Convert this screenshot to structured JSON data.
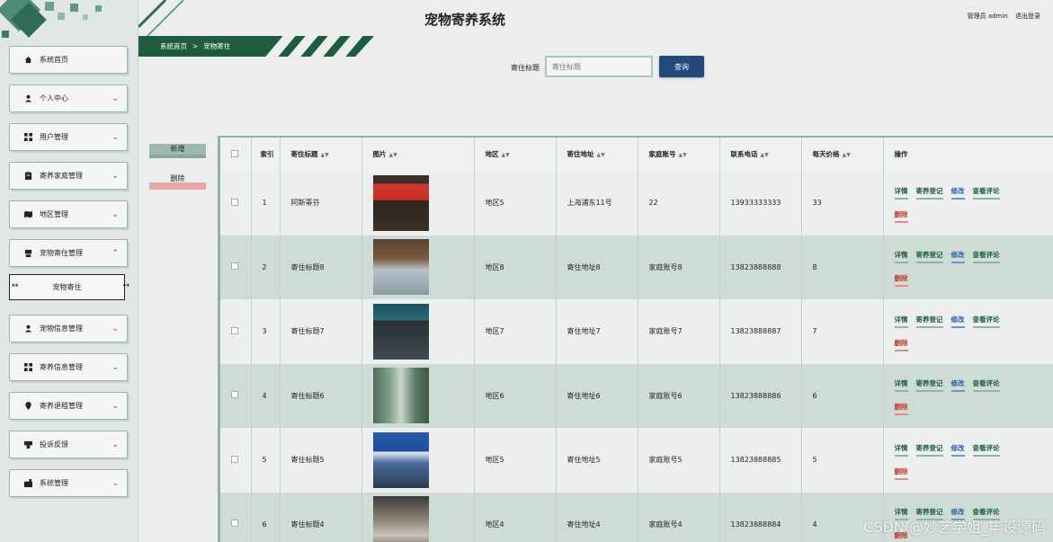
{
  "header": {
    "title": "宠物寄养系统",
    "user": "管理员 admin",
    "logout": "退出登录"
  },
  "sidebar": {
    "items": [
      {
        "label": "系统首页",
        "icon": "home-icon",
        "has_chevron": false
      },
      {
        "label": "个人中心",
        "icon": "person-icon",
        "has_chevron": true
      },
      {
        "label": "用户管理",
        "icon": "grid-icon",
        "has_chevron": true
      },
      {
        "label": "寄养家庭管理",
        "icon": "clipboard-icon",
        "has_chevron": true
      },
      {
        "label": "地区管理",
        "icon": "map-icon",
        "has_chevron": true
      },
      {
        "label": "宠物寄住管理",
        "icon": "house-icon",
        "has_chevron": true
      },
      {
        "label": "宠物信息管理",
        "icon": "person-icon",
        "has_chevron": true
      },
      {
        "label": "寄养信息管理",
        "icon": "grid-icon",
        "has_chevron": true
      },
      {
        "label": "寄养退租管理",
        "icon": "pin-icon",
        "has_chevron": true
      },
      {
        "label": "投诉反馈",
        "icon": "feedback-icon",
        "has_chevron": true
      },
      {
        "label": "系统管理",
        "icon": "gear-icon",
        "has_chevron": true
      }
    ],
    "sub_item": "宠物寄住"
  },
  "breadcrumb": {
    "home": "系统首页",
    "separator": ">",
    "current": "宠物寄住"
  },
  "search": {
    "label": "寄住标题",
    "placeholder": "寄住标题",
    "button": "查询"
  },
  "actions": {
    "add": "新增",
    "delete": "删除"
  },
  "table": {
    "columns": [
      "索引",
      "寄住标题",
      "图片",
      "地区",
      "寄住地址",
      "家庭账号",
      "联系电话",
      "每天价格",
      "操作"
    ],
    "ops": {
      "detail": "详情",
      "register": "寄养登记",
      "edit": "修改",
      "comments": "查看评论",
      "delete": "删除"
    },
    "rows": [
      {
        "index": "1",
        "title": "阿斯蒂芬",
        "region": "地区5",
        "address": "上海浦东11号",
        "account": "22",
        "phone": "13933333333",
        "price": "33",
        "image": "storefront-red"
      },
      {
        "index": "2",
        "title": "寄住标题8",
        "region": "地区8",
        "address": "寄住地址8",
        "account": "家庭账号8",
        "phone": "13823888888",
        "price": "8",
        "image": "interior-shop"
      },
      {
        "index": "3",
        "title": "寄住标题7",
        "region": "地区7",
        "address": "寄住地址7",
        "account": "家庭账号7",
        "phone": "13823888887",
        "price": "7",
        "image": "storefront-dark"
      },
      {
        "index": "4",
        "title": "寄住标题6",
        "region": "地区6",
        "address": "寄住地址6",
        "account": "家庭账号6",
        "phone": "13823888886",
        "price": "6",
        "image": "storefront-green"
      },
      {
        "index": "5",
        "title": "寄住标题5",
        "region": "地区5",
        "address": "寄住地址5",
        "account": "家庭账号5",
        "phone": "13823888885",
        "price": "5",
        "image": "storefront-blue"
      },
      {
        "index": "6",
        "title": "寄住标题4",
        "region": "地区4",
        "address": "寄住地址4",
        "account": "家庭账号4",
        "phone": "13823888884",
        "price": "4",
        "image": "interior-hall"
      }
    ]
  },
  "watermark": "CSDN @妙艺学姐_毕设源码",
  "colors": {
    "brand_green": "#1e5c3e",
    "search_button": "#234a7a",
    "row_alt": "#cfdcd6",
    "delete_red": "#e8a7a7"
  }
}
